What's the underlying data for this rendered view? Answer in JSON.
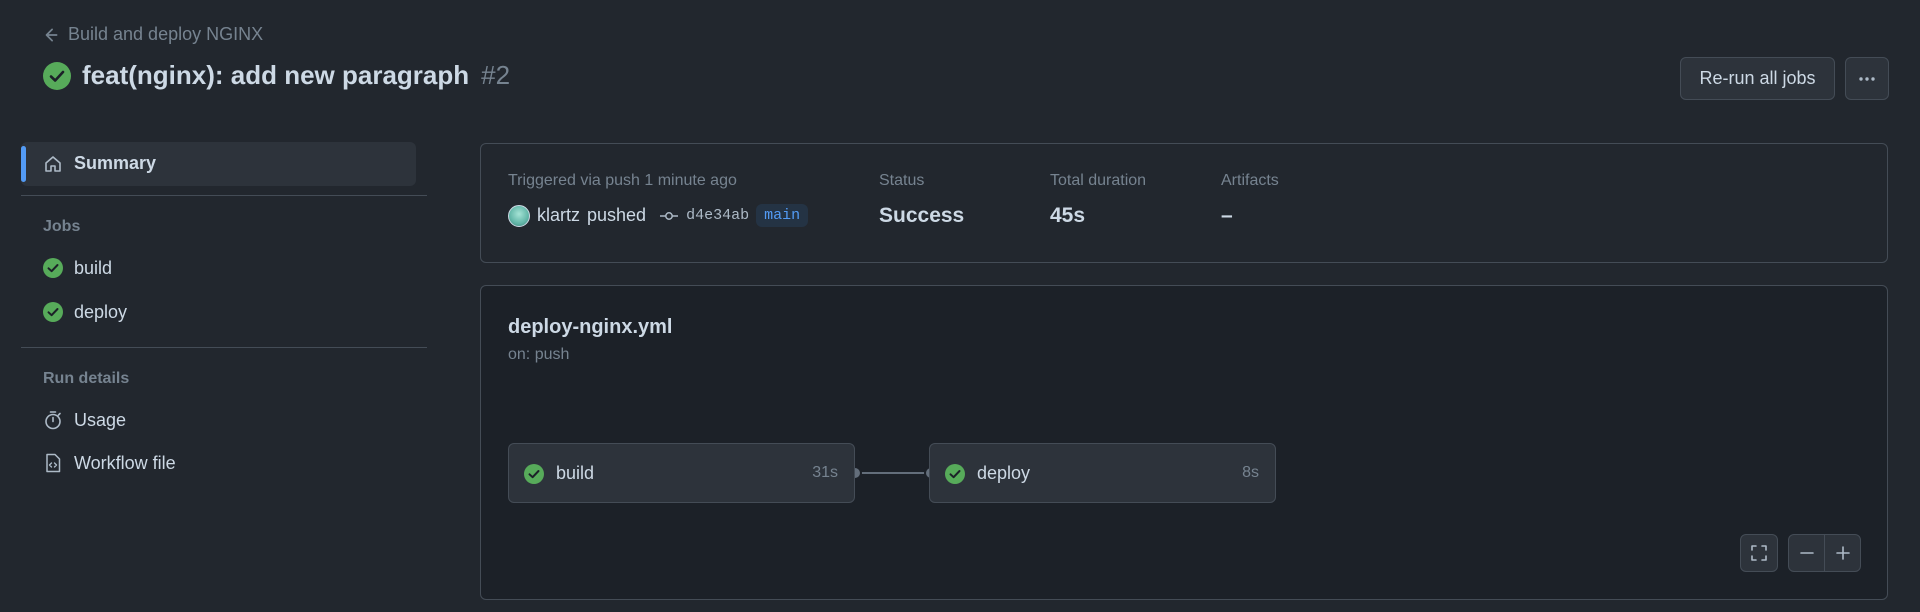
{
  "header": {
    "back_label": "Build and deploy NGINX",
    "title": "feat(nginx): add new paragraph",
    "run_number": "#2",
    "rerun_label": "Re-run all jobs"
  },
  "sidebar": {
    "summary_label": "Summary",
    "jobs_heading": "Jobs",
    "jobs": [
      {
        "label": "build"
      },
      {
        "label": "deploy"
      }
    ],
    "run_details_heading": "Run details",
    "details": [
      {
        "label": "Usage",
        "icon": "stopwatch-icon"
      },
      {
        "label": "Workflow file",
        "icon": "file-code-icon"
      }
    ]
  },
  "summary": {
    "trigger_label": "Triggered via push 1 minute ago",
    "actor": "klartz",
    "action": "pushed",
    "commit_sha": "d4e34ab",
    "branch": "main",
    "status_label": "Status",
    "status_value": "Success",
    "duration_label": "Total duration",
    "duration_value": "45s",
    "artifacts_label": "Artifacts",
    "artifacts_value": "–"
  },
  "workflow": {
    "file": "deploy-nginx.yml",
    "trigger": "on: push",
    "jobs": [
      {
        "name": "build",
        "duration": "31s"
      },
      {
        "name": "deploy",
        "duration": "8s"
      }
    ]
  },
  "colors": {
    "success": "#57ab5a",
    "accent": "#539bf5",
    "background": "#22272e"
  }
}
